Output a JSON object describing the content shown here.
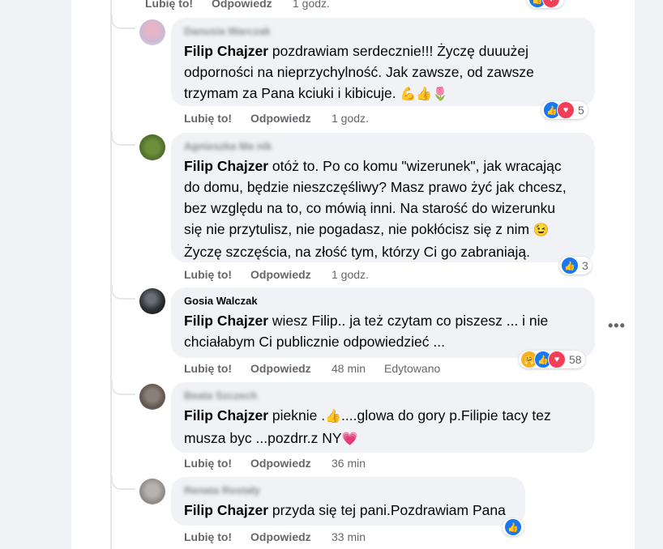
{
  "labels": {
    "like": "Lubię to!",
    "reply": "Odpowiedz",
    "edited": "Edytowano",
    "more": "•••"
  },
  "top_actions": {
    "time": "1 godz."
  },
  "comments": [
    {
      "author": "Danusia Warczak",
      "mention": "Filip Chajzer",
      "lines": [
        " pozdrawiam serdecznie!!! Życzę duuużej",
        "odporności na nieprzychylność. Jak zawsze, od zawsze",
        "trzymam za Pana kciuki i kibicuje. "
      ],
      "emoji": "💪👍🌷",
      "time": "1 godz.",
      "reaction_count": "5"
    },
    {
      "author": "Agnieszka Ma nik",
      "mention": "Filip Chajzer",
      "lines": [
        " otóż to. Po co komu \"wizerunek\", jak wracając",
        "do domu, będzie nieszczęśliwy? Masz prawo żyć jak chcesz,",
        "bez względu na to, co mówią inni. Na starość do wizerunku",
        "się nie przytulisz, nie pogadasz, nie pokłócisz się z nim ",
        "Życzę szczęścia, na złość tym, którzy Ci go zabraniają."
      ],
      "emoji": "😉",
      "time": "1 godz.",
      "reaction_count": "3"
    },
    {
      "author": "Gosia Walczak",
      "mention": "Filip Chajzer",
      "lines": [
        " wiesz Filip.. ja też czytam co piszesz ... i nie",
        "chciałabym Ci publicznie odpowiedzieć ..."
      ],
      "time": "48 min",
      "reaction_count": "58"
    },
    {
      "author": "Beata Szczech",
      "mention": "Filip Chajzer",
      "lines": [
        " pieknie .",
        "....glowa do gory p.Filipie tacy tez",
        "musza byc ...pozdrr.z NY"
      ],
      "emoji_a": "👍",
      "emoji_b": "💗",
      "time": "36 min"
    },
    {
      "author": "Renata Rostały",
      "mention": "Filip Chajzer",
      "lines": [
        " przyda się tej pani.Pozdrawiam Pana"
      ],
      "time": "33 min",
      "reaction_count": ""
    }
  ],
  "colors": {
    "like": "#1877f2",
    "love": "#f33e58",
    "bubble": "#f0f2f5",
    "meta": "#65676b"
  }
}
